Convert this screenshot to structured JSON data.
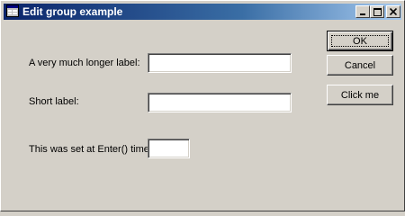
{
  "window": {
    "title": "Edit group example"
  },
  "fields": [
    {
      "label": "A very much longer label:",
      "value": ""
    },
    {
      "label": "Short label:",
      "value": ""
    },
    {
      "label": "This was set at Enter() time:",
      "value": ""
    }
  ],
  "buttons": {
    "ok": "OK",
    "cancel": "Cancel",
    "click_me": "Click me"
  },
  "colors": {
    "face": "#d4d0c8",
    "titlebar_start": "#0a246a",
    "titlebar_end": "#a6caf0"
  }
}
